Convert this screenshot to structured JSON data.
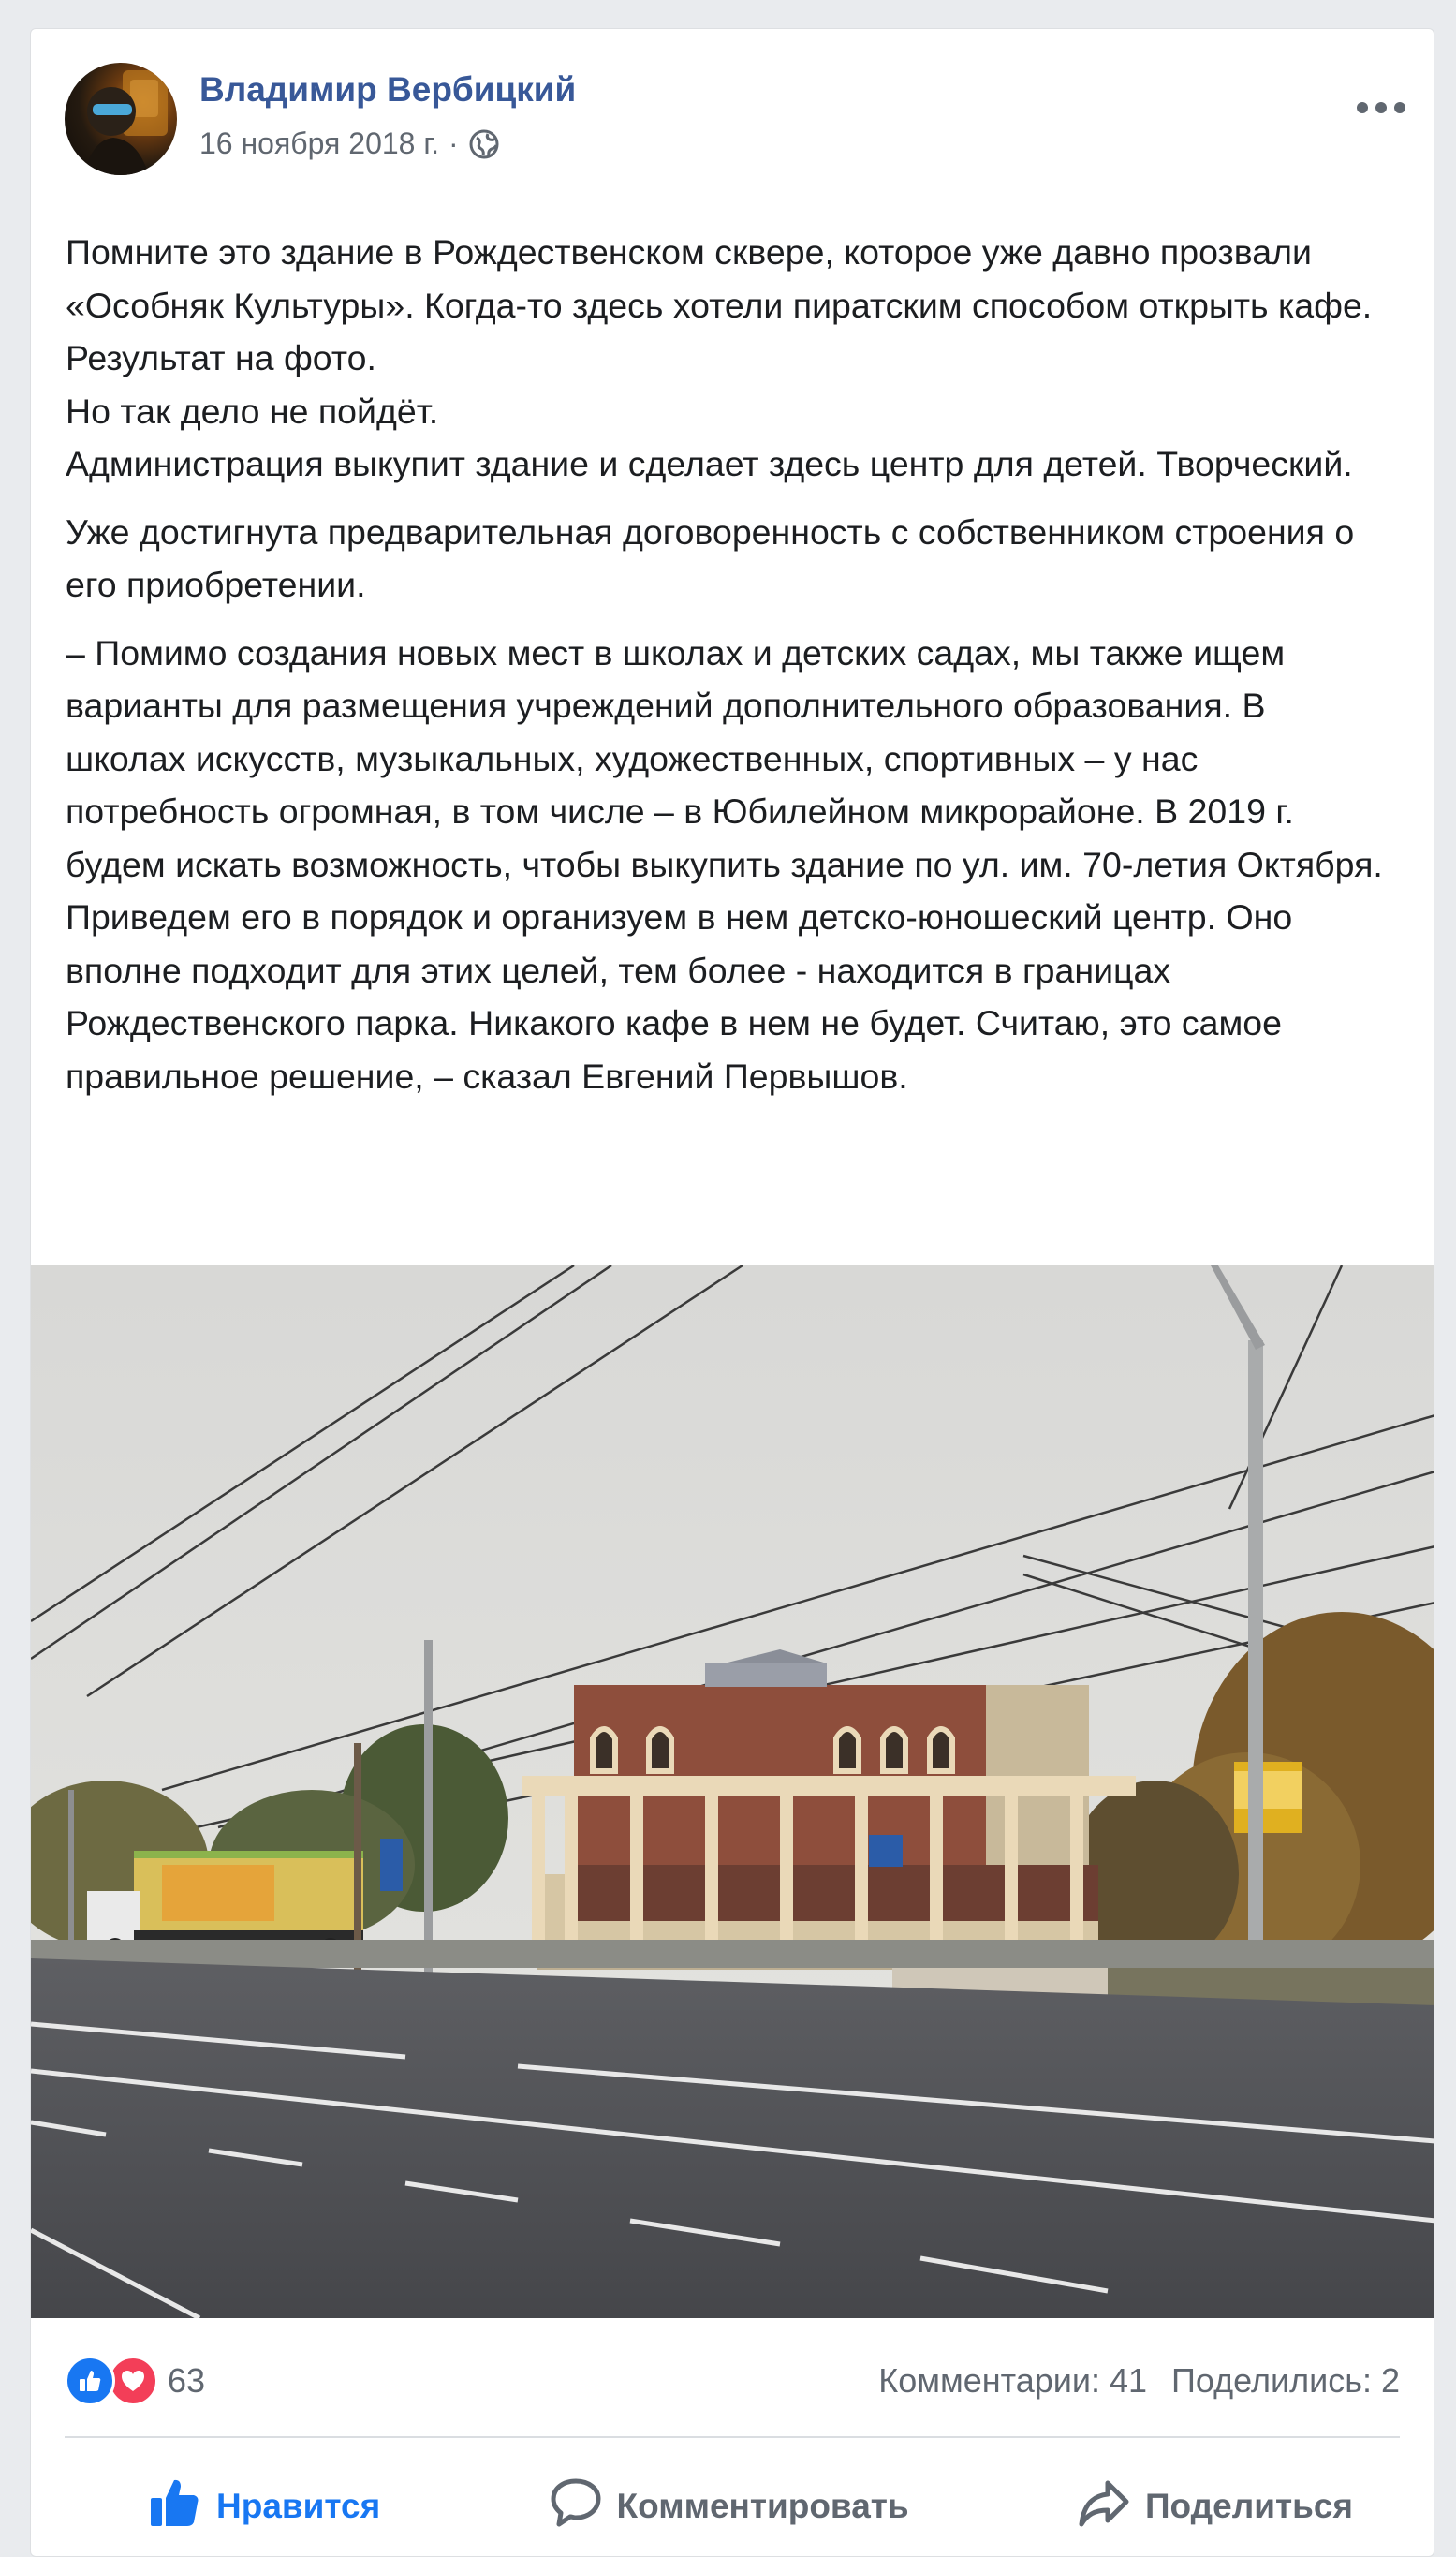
{
  "post": {
    "author": "Владимир Вербицкий",
    "date": "16 ноября 2018 г.",
    "separator": "·",
    "privacy_icon": "globe-icon",
    "more_icon": "more-icon"
  },
  "text": {
    "paragraphs": [
      "Помните это здание в Рождественском сквере, которое уже давно прозвали «Особняк Культуры». Когда-то здесь хотели пиратским способом открыть кафе.\nРезультат на фото.\nНо так дело не пойдёт.\nАдминистрация выкупит здание и сделает здесь центр для детей. Творческий.",
      "Уже достигнута предварительная договоренность с собственником строения о его приобретении.",
      "– Помимо создания новых мест в школах и детских садах, мы также ищем варианты для размещения учреждений дополнительного образования. В школах искусств, музыкальных, художественных, спортивных – у нас потребность огромная, в том числе – в Юбилейном микрорайоне. В 2019 г. будем искать возможность, чтобы выкупить здание по ул. им. 70-летия Октября. Приведем его в порядок и организуем в нем детско-юношеский центр. Оно вполне подходит для этих целей, тем более - находится в границах Рождественского парка. Никакого кафе в нем не будет. Считаю, это самое правильное решение, – сказал Евгений Первышов."
    ]
  },
  "reactions": {
    "count": "63",
    "icons": [
      "like-icon",
      "love-icon"
    ],
    "comments": "Комментарии: 41",
    "shares": "Поделились: 2"
  },
  "actions": {
    "like": "Нравится",
    "comment": "Комментировать",
    "share": "Поделиться"
  },
  "colors": {
    "author": "#385898",
    "like_active": "#1877f2",
    "love": "#f33e58",
    "muted": "#606770"
  }
}
